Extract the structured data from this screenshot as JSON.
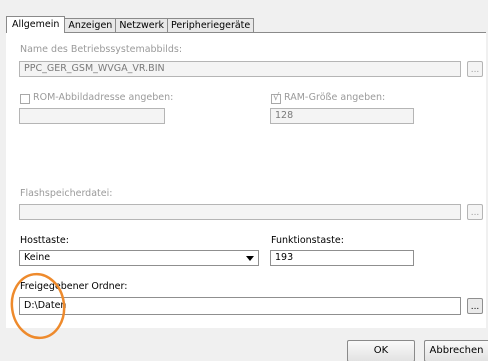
{
  "tabs": [
    "Allgemein",
    "Anzeigen",
    "Netzwerk",
    "Peripheriegeräte"
  ],
  "os_image": {
    "label": "Name des Betriebssystemabbilds:",
    "value": "PPC_GER_GSM_WVGA_VR.BIN",
    "browse_label": "..."
  },
  "rom_address": {
    "label": "ROM-Abbildadresse angeben:",
    "value": ""
  },
  "ram_size": {
    "label": "RAM-Größe angeben:",
    "value": "128",
    "check_mark": "√"
  },
  "flash_file": {
    "label": "Flashspeicherdatei:",
    "value": "",
    "browse_label": "..."
  },
  "host_key": {
    "label": "Hosttaste:",
    "value": "Keine"
  },
  "function_key": {
    "label": "Funktionstaste:",
    "value": "193"
  },
  "shared_folder": {
    "label": "Freigegebener Ordner:",
    "value": "D:\\Daten",
    "browse_label": "..."
  },
  "buttons": {
    "ok": "OK",
    "cancel": "Abbrechen"
  },
  "colors": {
    "highlight": "#ee8a2c"
  }
}
